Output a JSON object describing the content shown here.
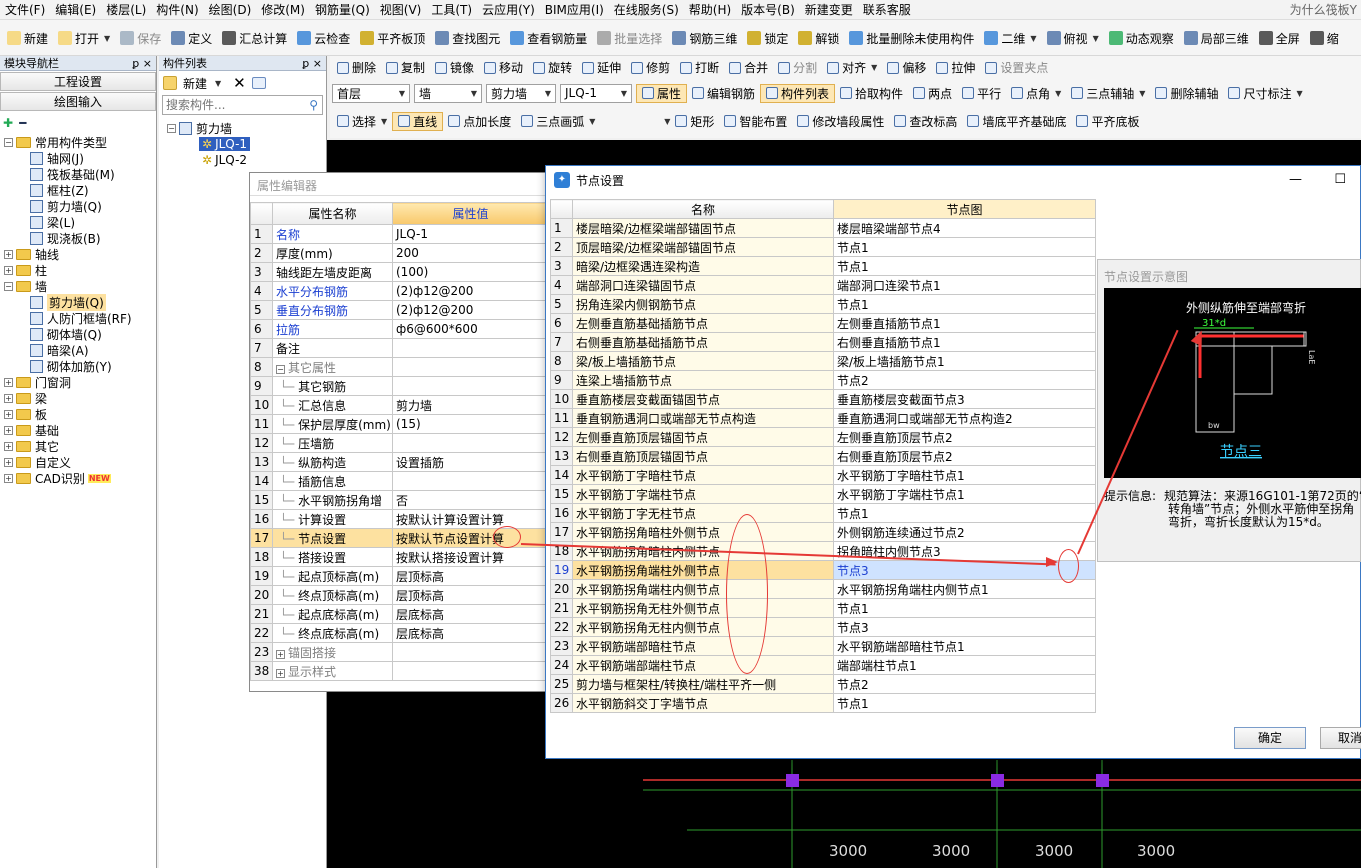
{
  "menu": [
    "文件(F)",
    "编辑(E)",
    "楼层(L)",
    "构件(N)",
    "绘图(D)",
    "修改(M)",
    "钢筋量(Q)",
    "视图(V)",
    "工具(T)",
    "云应用(Y)",
    "BIM应用(I)",
    "在线服务(S)",
    "帮助(H)",
    "版本号(B)",
    "新建变更",
    "联系客服"
  ],
  "menu_right": "为什么筏板Y",
  "toolbar1": [
    "新建",
    "打开",
    "保存",
    "定义",
    "汇总计算",
    "云检查",
    "平齐板顶",
    "查找图元",
    "查看钢筋量",
    "批量选择",
    "钢筋三维",
    "锁定",
    "解锁",
    "批量删除未使用构件",
    "二维",
    "俯视",
    "动态观察",
    "局部三维",
    "全屏",
    "缩"
  ],
  "nav": {
    "title": "模块导航栏",
    "pin": "ꝑ ×",
    "btn1": "工程设置",
    "btn2": "绘图输入",
    "tree": [
      {
        "label": "常用构件类型",
        "level": 0,
        "exp": "−"
      },
      {
        "label": "轴网(J)",
        "level": 1
      },
      {
        "label": "筏板基础(M)",
        "level": 1
      },
      {
        "label": "框柱(Z)",
        "level": 1
      },
      {
        "label": "剪力墙(Q)",
        "level": 1
      },
      {
        "label": "梁(L)",
        "level": 1
      },
      {
        "label": "现浇板(B)",
        "level": 1
      },
      {
        "label": "轴线",
        "level": 0,
        "exp": "+"
      },
      {
        "label": "柱",
        "level": 0,
        "exp": "+"
      },
      {
        "label": "墙",
        "level": 0,
        "exp": "−"
      },
      {
        "label": "剪力墙(Q)",
        "level": 1,
        "sel": true
      },
      {
        "label": "人防门框墙(RF)",
        "level": 1
      },
      {
        "label": "砌体墙(Q)",
        "level": 1
      },
      {
        "label": "暗梁(A)",
        "level": 1
      },
      {
        "label": "砌体加筋(Y)",
        "level": 1
      },
      {
        "label": "门窗洞",
        "level": 0,
        "exp": "+"
      },
      {
        "label": "梁",
        "level": 0,
        "exp": "+"
      },
      {
        "label": "板",
        "level": 0,
        "exp": "+"
      },
      {
        "label": "基础",
        "level": 0,
        "exp": "+"
      },
      {
        "label": "其它",
        "level": 0,
        "exp": "+"
      },
      {
        "label": "自定义",
        "level": 0,
        "exp": "+"
      },
      {
        "label": "CAD识别",
        "level": 0,
        "exp": "+",
        "badge": "NEW"
      }
    ]
  },
  "complist": {
    "title": "构件列表",
    "pin": "ꝑ ×",
    "new": "新建",
    "search_placeholder": "搜索构件...",
    "root": "剪力墙",
    "items": [
      "JLQ-1",
      "JLQ-2"
    ]
  },
  "toolbar2": [
    "删除",
    "复制",
    "镜像",
    "移动",
    "旋转",
    "延伸",
    "修剪",
    "打断",
    "合并",
    "分割",
    "对齐",
    "偏移",
    "拉伸",
    "设置夹点"
  ],
  "toolbar3": {
    "combos": [
      "首层",
      "墙",
      "剪力墙",
      "JLQ-1"
    ],
    "buttons": [
      "属性",
      "编辑钢筋",
      "构件列表",
      "拾取构件",
      "两点",
      "平行",
      "点角",
      "三点辅轴",
      "删除辅轴",
      "尺寸标注"
    ]
  },
  "toolbar4": [
    "选择",
    "直线",
    "点加长度",
    "三点画弧",
    "矩形",
    "智能布置",
    "修改墙段属性",
    "查改标高",
    "墙底平齐基础底",
    "平齐底板"
  ],
  "prop": {
    "title": "属性编辑器",
    "h_name": "属性名称",
    "h_value": "属性值",
    "rows": [
      {
        "n": "1",
        "name": "名称",
        "value": "JLQ-1",
        "blue": true
      },
      {
        "n": "2",
        "name": "厚度(mm)",
        "value": "200"
      },
      {
        "n": "3",
        "name": "轴线距左墙皮距离",
        "value": "(100)"
      },
      {
        "n": "4",
        "name": "水平分布钢筋",
        "value": "(2)ф12@200",
        "blue": true
      },
      {
        "n": "5",
        "name": "垂直分布钢筋",
        "value": "(2)ф12@200",
        "blue": true
      },
      {
        "n": "6",
        "name": "拉筋",
        "value": "ф6@600*600",
        "blue": true
      },
      {
        "n": "7",
        "name": "备注",
        "value": ""
      },
      {
        "n": "8",
        "name": "其它属性",
        "value": "",
        "group": "−",
        "gray": true
      },
      {
        "n": "9",
        "name": "其它钢筋",
        "value": "",
        "sub": true
      },
      {
        "n": "10",
        "name": "汇总信息",
        "value": "剪力墙",
        "sub": true
      },
      {
        "n": "11",
        "name": "保护层厚度(mm)",
        "value": "(15)",
        "sub": true
      },
      {
        "n": "12",
        "name": "压墙筋",
        "value": "",
        "sub": true
      },
      {
        "n": "13",
        "name": "纵筋构造",
        "value": "设置插筋",
        "sub": true
      },
      {
        "n": "14",
        "name": "插筋信息",
        "value": "",
        "sub": true
      },
      {
        "n": "15",
        "name": "水平钢筋拐角增",
        "value": "否",
        "sub": true
      },
      {
        "n": "16",
        "name": "计算设置",
        "value": "按默认计算设置计算",
        "sub": true
      },
      {
        "n": "17",
        "name": "节点设置",
        "value": "按默认节点设置计算",
        "sub": true,
        "sel": true
      },
      {
        "n": "18",
        "name": "搭接设置",
        "value": "按默认搭接设置计算",
        "sub": true
      },
      {
        "n": "19",
        "name": "起点顶标高(m)",
        "value": "层顶标高",
        "sub": true
      },
      {
        "n": "20",
        "name": "终点顶标高(m)",
        "value": "层顶标高",
        "sub": true
      },
      {
        "n": "21",
        "name": "起点底标高(m)",
        "value": "层底标高",
        "sub": true
      },
      {
        "n": "22",
        "name": "终点底标高(m)",
        "value": "层底标高",
        "sub": true
      },
      {
        "n": "23",
        "name": "锚固搭接",
        "value": "",
        "group": "+",
        "gray": true
      },
      {
        "n": "38",
        "name": "显示样式",
        "value": "",
        "group": "+",
        "gray": true
      }
    ]
  },
  "node": {
    "title": "节点设置",
    "min": "—",
    "max": "☐",
    "h_name": "名称",
    "h_fig": "节点图",
    "rows": [
      {
        "n": "1",
        "name": "楼层暗梁/边框梁端部锚固节点",
        "fig": "楼层暗梁端部节点4"
      },
      {
        "n": "2",
        "name": "顶层暗梁/边框梁端部锚固节点",
        "fig": "节点1"
      },
      {
        "n": "3",
        "name": "暗梁/边框梁遇连梁构造",
        "fig": "节点1"
      },
      {
        "n": "4",
        "name": "端部洞口连梁锚固节点",
        "fig": "端部洞口连梁节点1"
      },
      {
        "n": "5",
        "name": "拐角连梁内侧钢筋节点",
        "fig": "节点1"
      },
      {
        "n": "6",
        "name": "左侧垂直筋基础插筋节点",
        "fig": "左侧垂直插筋节点1"
      },
      {
        "n": "7",
        "name": "右侧垂直筋基础插筋节点",
        "fig": "右侧垂直插筋节点1"
      },
      {
        "n": "8",
        "name": "梁/板上墙插筋节点",
        "fig": "梁/板上墙插筋节点1"
      },
      {
        "n": "9",
        "name": "连梁上墙插筋节点",
        "fig": "节点2"
      },
      {
        "n": "10",
        "name": "垂直筋楼层变截面锚固节点",
        "fig": "垂直筋楼层变截面节点3"
      },
      {
        "n": "11",
        "name": "垂直钢筋遇洞口或端部无节点构造",
        "fig": "垂直筋遇洞口或端部无节点构造2"
      },
      {
        "n": "12",
        "name": "左侧垂直筋顶层锚固节点",
        "fig": "左侧垂直筋顶层节点2"
      },
      {
        "n": "13",
        "name": "右侧垂直筋顶层锚固节点",
        "fig": "右侧垂直筋顶层节点2"
      },
      {
        "n": "14",
        "name": "水平钢筋丁字暗柱节点",
        "fig": "水平钢筋丁字暗柱节点1"
      },
      {
        "n": "15",
        "name": "水平钢筋丁字端柱节点",
        "fig": "水平钢筋丁字端柱节点1"
      },
      {
        "n": "16",
        "name": "水平钢筋丁字无柱节点",
        "fig": "节点1"
      },
      {
        "n": "17",
        "name": "水平钢筋拐角暗柱外侧节点",
        "fig": "外侧钢筋连续通过节点2"
      },
      {
        "n": "18",
        "name": "水平钢筋拐角暗柱内侧节点",
        "fig": "拐角暗柱内侧节点3"
      },
      {
        "n": "19",
        "name": "水平钢筋拐角端柱外侧节点",
        "fig": "节点3",
        "sel": true
      },
      {
        "n": "20",
        "name": "水平钢筋拐角端柱内侧节点",
        "fig": "水平钢筋拐角端柱内侧节点1"
      },
      {
        "n": "21",
        "name": "水平钢筋拐角无柱外侧节点",
        "fig": "节点1"
      },
      {
        "n": "22",
        "name": "水平钢筋拐角无柱内侧节点",
        "fig": "节点3"
      },
      {
        "n": "23",
        "name": "水平钢筋端部暗柱节点",
        "fig": "水平钢筋端部暗柱节点1"
      },
      {
        "n": "24",
        "name": "水平钢筋端部端柱节点",
        "fig": "端部端柱节点1"
      },
      {
        "n": "25",
        "name": "剪力墙与框架柱/转换柱/端柱平齐一侧",
        "fig": "节点2"
      },
      {
        "n": "26",
        "name": "水平钢筋斜交丁字墙节点",
        "fig": "节点1"
      }
    ],
    "preview_title": "节点设置示意图",
    "img_caption": "外侧纵筋伸至端部弯折",
    "img_dim": "31*d",
    "img_label": "节点三",
    "img_bw": "bw",
    "img_lae": "LaE",
    "hint_label": "提示信息:",
    "hint_line1": "规范算法：来源16G101-1第72页的“",
    "hint_line2": "转角墙”节点；外侧水平筋伸至拐角",
    "hint_line3": "弯折，弯折长度默认为15*d。",
    "ok": "确定",
    "cancel": "取消"
  },
  "canvas": {
    "dims": [
      "3000",
      "3000",
      "3000",
      "3000"
    ]
  },
  "colors": {
    "accent": "#1b3fd1",
    "selected": "#fde1a0",
    "annotation": "#e53935",
    "wall_line": "#e53935",
    "axis": "#2e9b2e",
    "column": "#8a2be2"
  }
}
